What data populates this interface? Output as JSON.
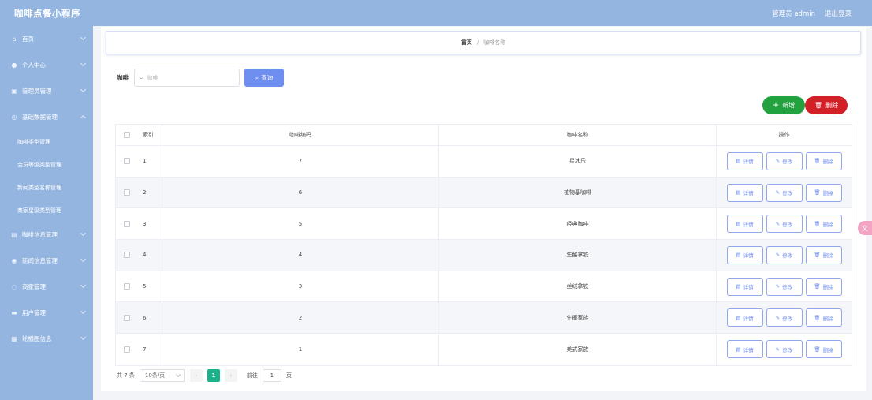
{
  "header": {
    "title": "咖啡点餐小程序",
    "user": "管理员 admin",
    "logout": "退出登录"
  },
  "sidebar": {
    "items": [
      {
        "label": "首页",
        "icon": "home-icon",
        "glyph": "⌂"
      },
      {
        "label": "个人中心",
        "icon": "user-icon",
        "glyph": "●"
      },
      {
        "label": "管理员管理",
        "icon": "admin-icon",
        "glyph": "▣"
      },
      {
        "label": "基础数据管理",
        "icon": "data-icon",
        "glyph": "◎"
      }
    ],
    "subitems": [
      "咖啡类型管理",
      "会员等级类型管理",
      "新闻类型名称管理",
      "商家星级类型管理"
    ],
    "items2": [
      {
        "label": "咖啡信息管理",
        "icon": "coffee-icon",
        "glyph": "▤"
      },
      {
        "label": "新闻信息管理",
        "icon": "news-icon",
        "glyph": "◉"
      },
      {
        "label": "商家管理",
        "icon": "shop-icon",
        "glyph": "◌"
      },
      {
        "label": "用户管理",
        "icon": "users-icon",
        "glyph": "▬"
      },
      {
        "label": "轮播图信息",
        "icon": "carousel-icon",
        "glyph": "▦"
      }
    ]
  },
  "breadcrumb": {
    "home": "首页",
    "sep": "/",
    "current": "咖啡名称"
  },
  "search": {
    "label": "咖啡",
    "placeholder": "咖啡",
    "button": "查询"
  },
  "actions": {
    "add": "新增",
    "delete": "删除"
  },
  "table": {
    "headers": {
      "index": "索引",
      "code": "咖啡编码",
      "name": "咖啡名称",
      "ops": "操作"
    },
    "ops": {
      "detail": "详情",
      "edit": "修改",
      "delete": "删除"
    },
    "rows": [
      {
        "index": "1",
        "code": "7",
        "name": "星冰乐"
      },
      {
        "index": "2",
        "code": "6",
        "name": "植物基咖啡"
      },
      {
        "index": "3",
        "code": "5",
        "name": "经典咖啡"
      },
      {
        "index": "4",
        "code": "4",
        "name": "生酪拿铁"
      },
      {
        "index": "5",
        "code": "3",
        "name": "丝绒拿铁"
      },
      {
        "index": "6",
        "code": "2",
        "name": "生椰家族"
      },
      {
        "index": "7",
        "code": "1",
        "name": "美式家族"
      }
    ]
  },
  "pagination": {
    "total": "共 7 条",
    "page_size": "10条/页",
    "current": "1",
    "goto_label": "前往",
    "goto_value": "1",
    "page_unit": "页"
  },
  "colors": {
    "sidebar": "#94b5e0",
    "primary": "#6f8ff0",
    "add": "#22a23e",
    "delete": "#d32027",
    "page_active": "#1bb18a"
  }
}
